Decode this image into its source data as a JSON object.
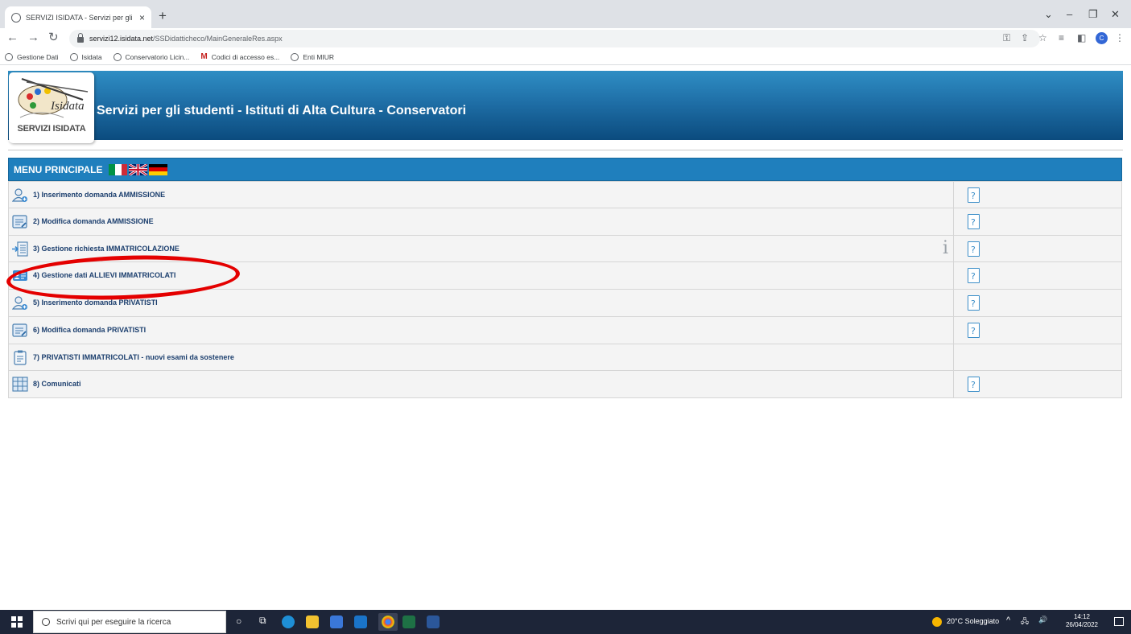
{
  "browser": {
    "tab_title": "SERVIZI ISIDATA - Servizi per gli s",
    "close_glyph": "×",
    "newtab_glyph": "+",
    "url_host": "servizi12.isidata.net",
    "url_path": "/SSDidatticheco/MainGeneraleRes.aspx",
    "profile_initial": "C",
    "bookmarks": [
      {
        "label": "Gestione Dati",
        "icon": "globe-icon"
      },
      {
        "label": "Isidata",
        "icon": "globe-icon"
      },
      {
        "label": "Conservatorio Licin...",
        "icon": "globe-icon"
      },
      {
        "label": "Codici di accesso es...",
        "icon": "gmail-icon"
      },
      {
        "label": "Enti MIUR",
        "icon": "globe-icon"
      }
    ]
  },
  "header": {
    "logo_text": "SERVIZI ISIDATA",
    "title": "Servizi per gli studenti - Istituti di Alta Cultura - Conservatori"
  },
  "menu": {
    "heading": "MENU PRINCIPALE",
    "flags": [
      "italy-flag",
      "uk-flag",
      "germany-flag"
    ],
    "items": [
      {
        "label": "1) Inserimento domanda AMMISSIONE",
        "icon": "user-add-icon",
        "help": true,
        "info": false
      },
      {
        "label": "2) Modifica domanda AMMISSIONE",
        "icon": "edit-document-icon",
        "help": true,
        "info": false
      },
      {
        "label": "3) Gestione richiesta IMMATRICOLAZIONE",
        "icon": "enrollment-icon",
        "help": true,
        "info": true
      },
      {
        "label": "4) Gestione dati ALLIEVI IMMATRICOLATI",
        "icon": "student-card-icon",
        "help": true,
        "info": false
      },
      {
        "label": "5) Inserimento domanda PRIVATISTI",
        "icon": "user-add-icon",
        "help": true,
        "info": false
      },
      {
        "label": "6) Modifica domanda PRIVATISTI",
        "icon": "edit-document-icon",
        "help": true,
        "info": false
      },
      {
        "label": "7) PRIVATISTI IMMATRICOLATI - nuovi esami da sostenere",
        "icon": "clipboard-icon",
        "help": false,
        "info": false
      },
      {
        "label": "8) Comunicati",
        "icon": "bulletin-icon",
        "help": true,
        "info": false
      }
    ],
    "highlighted_item": 4
  },
  "taskbar": {
    "search_placeholder": "Scrivi qui per eseguire la ricerca",
    "weather": "20°C Soleggiato",
    "time": "14:12",
    "date": "26/04/2022"
  },
  "colors": {
    "banner": "#1f6fa7",
    "menu_header": "#1f7fbd",
    "row_text": "#1c3f6e",
    "highlight_oval": "#e40000"
  }
}
